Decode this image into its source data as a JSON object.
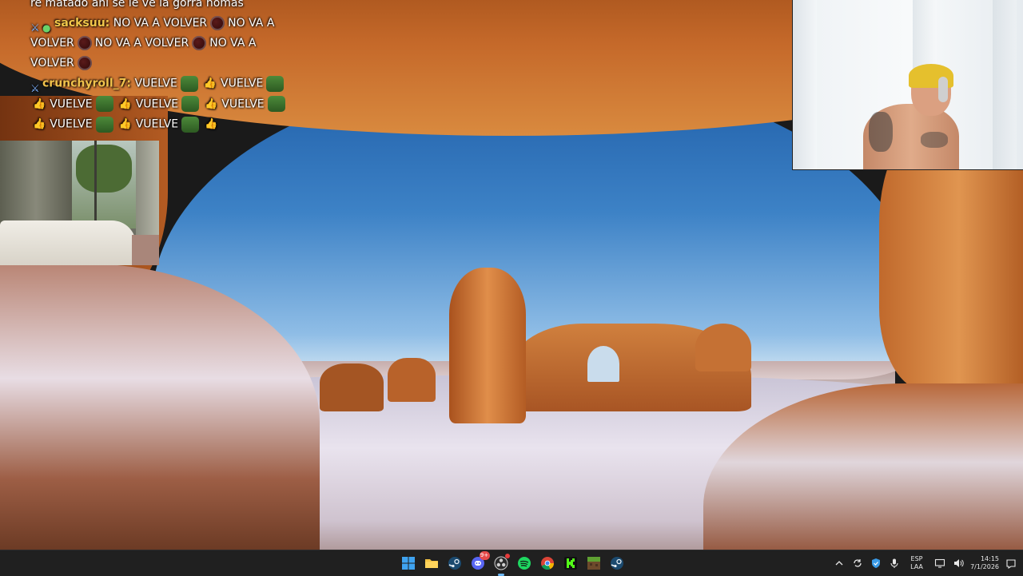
{
  "chat": {
    "lines": [
      {
        "text": "re matado ahi se le ve la gorra nomas"
      },
      {
        "username": "sacksuu",
        "message_parts": [
          "NO VA A VOLVER",
          "NO VA A",
          "VOLVER",
          "NO VA A VOLVER",
          "NO VA A",
          "VOLVER"
        ]
      },
      {
        "username": "crunchyroll_7",
        "message_parts": [
          "VUELVE",
          "VUELVE",
          "VUELVE",
          "VUELVE",
          "VUELVE",
          "VUELVE",
          "VUELVE"
        ]
      }
    ],
    "sacksuu_username": "sacksuu:",
    "crunchy_username": "crunchyroll_7:",
    "vuelve": "VUELVE"
  },
  "taskbar": {
    "apps": [
      {
        "name": "Start",
        "icon": "windows-start-icon"
      },
      {
        "name": "File Explorer",
        "icon": "folder-icon"
      },
      {
        "name": "Steam",
        "icon": "steam-icon"
      },
      {
        "name": "Discord",
        "icon": "discord-icon",
        "badge": "9+"
      },
      {
        "name": "OBS Studio",
        "icon": "obs-icon",
        "active": true
      },
      {
        "name": "Spotify",
        "icon": "spotify-icon"
      },
      {
        "name": "Google Chrome",
        "icon": "chrome-icon"
      },
      {
        "name": "Kick",
        "icon": "kick-icon"
      },
      {
        "name": "Minecraft",
        "icon": "minecraft-icon"
      },
      {
        "name": "Steam",
        "icon": "steam-icon"
      }
    ],
    "discord_badge": "9+",
    "tray": {
      "language_line1": "ESP",
      "language_line2": "LAA",
      "time": "14:15",
      "date": "7/1/2026"
    }
  },
  "colors": {
    "taskbar_bg": "#202020",
    "username": "#f2c74a",
    "accent": "#6cb8f6"
  }
}
